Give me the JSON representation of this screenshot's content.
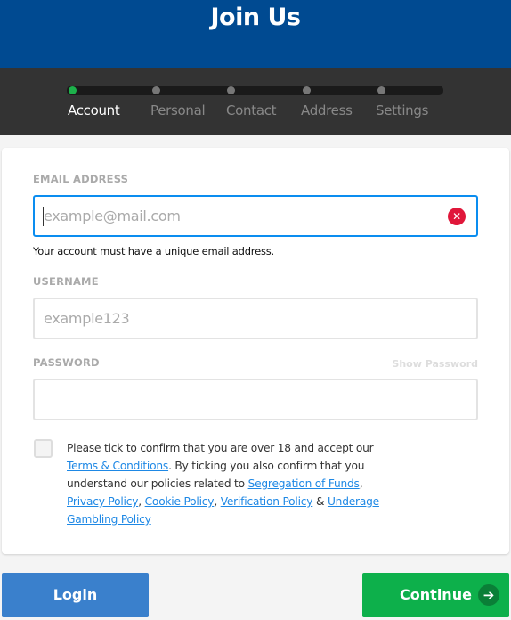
{
  "header": {
    "title": "Join Us"
  },
  "steps": [
    {
      "label": "Account",
      "active": true
    },
    {
      "label": "Personal",
      "active": false
    },
    {
      "label": "Contact",
      "active": false
    },
    {
      "label": "Address",
      "active": false
    },
    {
      "label": "Settings",
      "active": false
    }
  ],
  "form": {
    "email": {
      "label": "EMAIL ADDRESS",
      "placeholder": "example@mail.com",
      "hint": "Your account must have a unique email address.",
      "error_icon": "error-x-icon"
    },
    "username": {
      "label": "USERNAME",
      "placeholder": "example123"
    },
    "password": {
      "label": "PASSWORD",
      "show_label": "Show Password",
      "value": ""
    },
    "terms": {
      "t1": "Please tick to confirm that you are over 18 and accept our ",
      "l1": "Terms & Conditions",
      "t2": ". By ticking you also confirm that you understand our policies related to ",
      "l2": "Segregation of Funds",
      "t3": ", ",
      "l3": "Privacy Policy",
      "t4": ", ",
      "l4": "Cookie Policy",
      "t5": ", ",
      "l5": "Verification Policy",
      "t6": " & ",
      "l6": "Underage Gambling Policy",
      "checked": false
    }
  },
  "buttons": {
    "login": "Login",
    "continue": "Continue"
  },
  "colors": {
    "header": "#004a91",
    "steps_bg": "#333333",
    "active_step": "#1db14b",
    "focus": "#0a8df0",
    "error": "#e0173a",
    "login": "#3a80cc",
    "continue": "#0db04b",
    "link": "#1e88e5"
  }
}
